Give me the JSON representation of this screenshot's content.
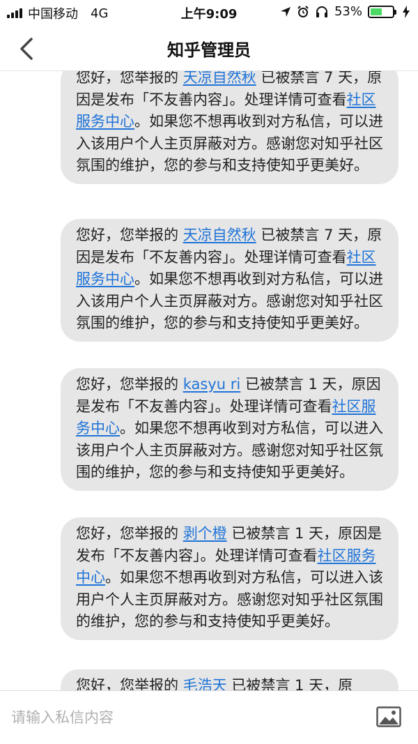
{
  "status_bar": {
    "carrier": "中国移动",
    "network": "4G",
    "time": "上午9:09",
    "battery_percent": "53%",
    "battery_level": 0.53,
    "icons": [
      "signal-icon",
      "location-icon",
      "alarm-icon",
      "headphones-icon",
      "battery-icon",
      "charging-icon"
    ]
  },
  "nav": {
    "title": "知乎管理员",
    "back_icon": "chevron-left-icon"
  },
  "messages": [
    {
      "pre": "您好，您举报的 ",
      "user": "天凉自然秋",
      "mid": " 已被禁言 7 天，原因是发布「不友善内容」。处理详情可查看",
      "link": "社区服务中心",
      "post": "。如果您不想再收到对方私信，可以进入该用户个人主页屏蔽对方。感谢您对知乎社区氛围的维护，您的参与和支持使知乎更美好。"
    },
    {
      "pre": "您好，您举报的 ",
      "user": "天凉自然秋",
      "mid": " 已被禁言 7 天，原因是发布「不友善内容」。处理详情可查看",
      "link": "社区服务中心",
      "post": "。如果您不想再收到对方私信，可以进入该用户个人主页屏蔽对方。感谢您对知乎社区氛围的维护，您的参与和支持使知乎更美好。"
    },
    {
      "pre": "您好，您举报的 ",
      "user": "kasyu ri",
      "mid": " 已被禁言 1 天，原因是发布「不友善内容」。处理详情可查看",
      "link": "社区服务中心",
      "post": "。如果您不想再收到对方私信，可以进入该用户个人主页屏蔽对方。感谢您对知乎社区氛围的维护，您的参与和支持使知乎更美好。"
    },
    {
      "pre": "您好，您举报的 ",
      "user": "剥个橙",
      "mid": " 已被禁言 1 天，原因是发布「不友善内容」。处理详情可查看",
      "link": "社区服务中心",
      "post": "。如果您不想再收到对方私信，可以进入该用户个人主页屏蔽对方。感谢您对知乎社区氛围的维护，您的参与和支持使知乎更美好。"
    },
    {
      "pre": "您好，您举报的 ",
      "user": "毛浩天",
      "mid": " 已被禁言 1 天，原",
      "link": "",
      "post": ""
    }
  ],
  "input_bar": {
    "placeholder": "请输入私信内容",
    "value": "",
    "image_icon": "image-icon"
  },
  "colors": {
    "bubble_bg": "#e6e6e6",
    "link": "#1e73d8",
    "battery": "#4cd964"
  }
}
